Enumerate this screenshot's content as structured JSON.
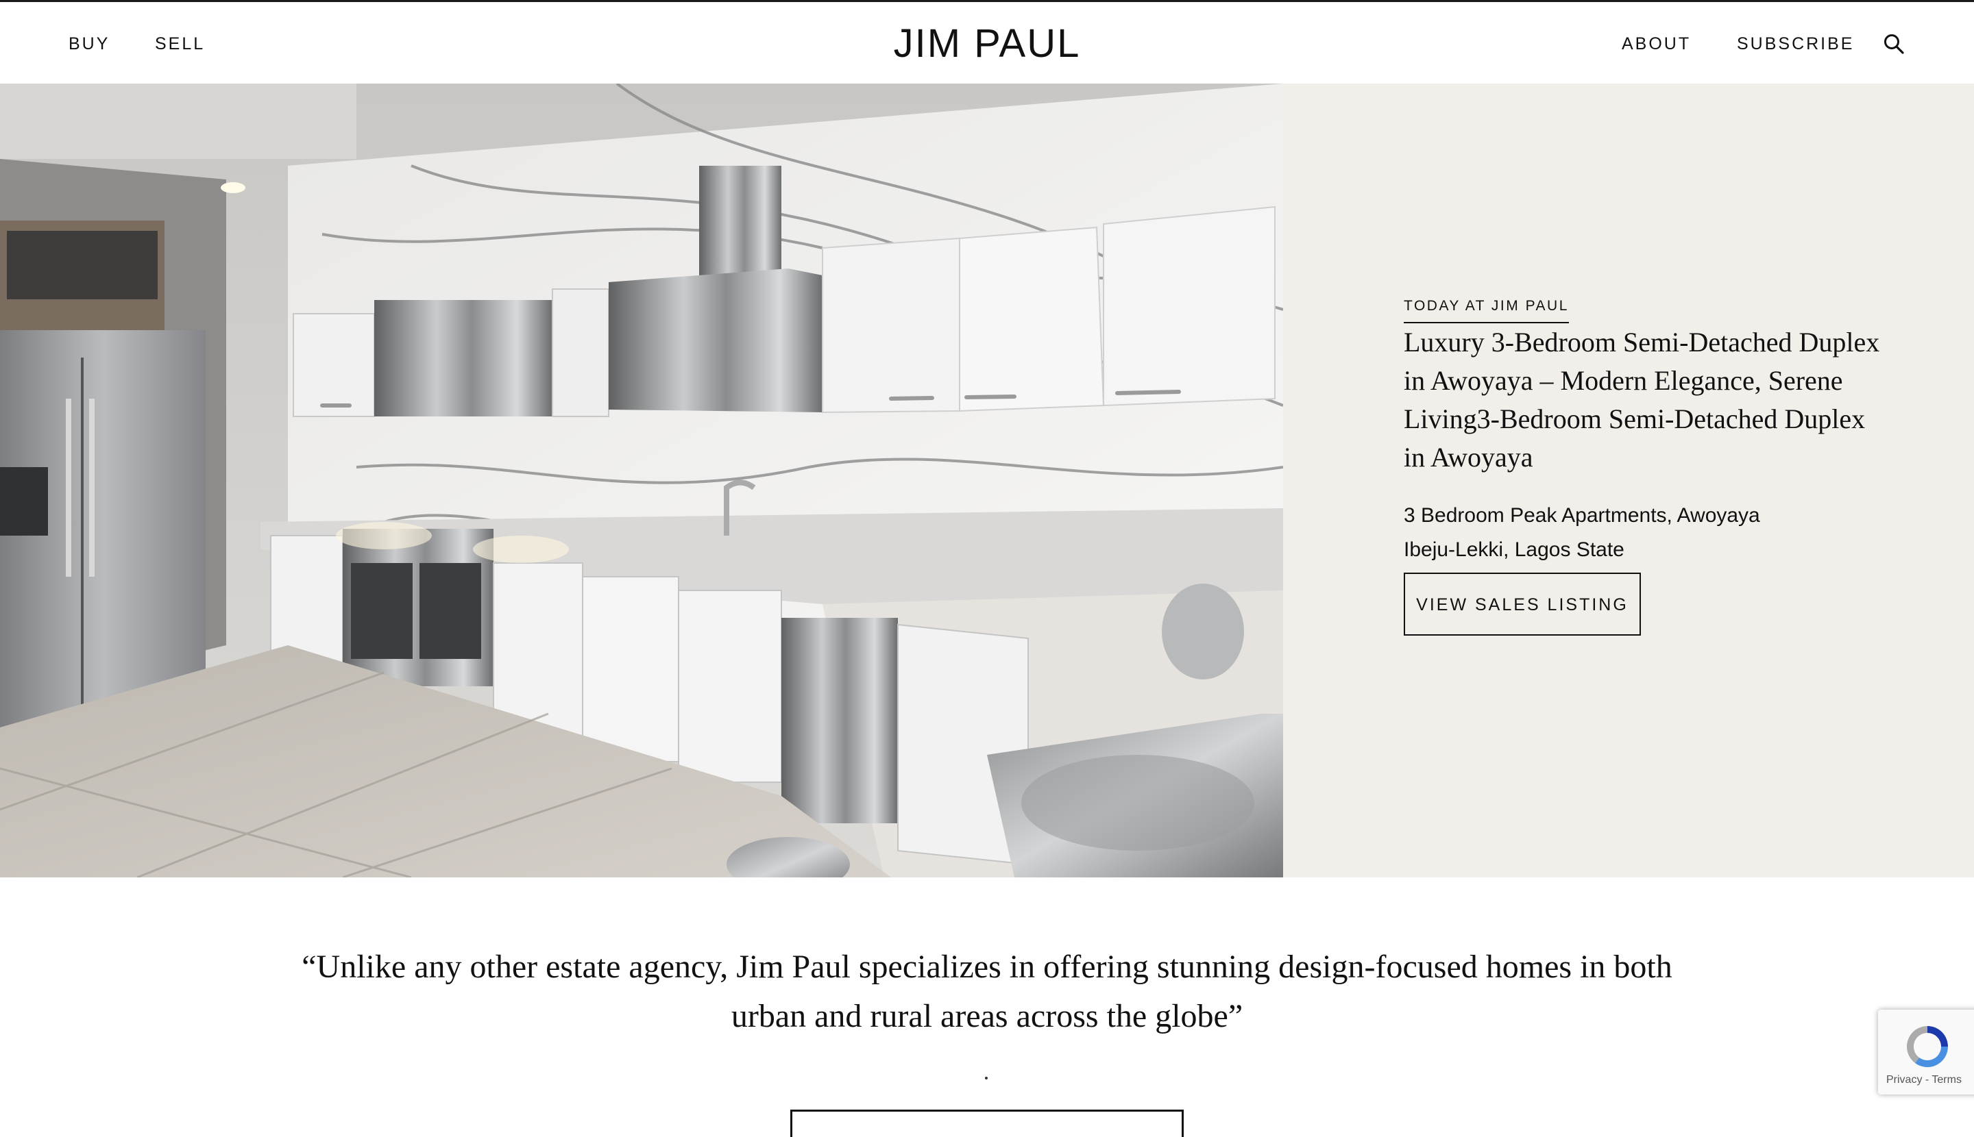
{
  "nav": {
    "buy": "BUY",
    "sell": "SELL",
    "logo": "JIM PAUL",
    "about": "ABOUT",
    "subscribe": "SUBSCRIBE"
  },
  "hero": {
    "eyebrow": "TODAY AT JIM PAUL",
    "headline": "Luxury 3-Bedroom Semi-Detached Duplex in Awoyaya – Modern Elegance, Serene Living3-Bedroom Semi-Detached Duplex in Awoyaya",
    "address_line1": "3 Bedroom Peak Apartments, Awoyaya",
    "address_line2": "Ibeju-Lekki, Lagos State",
    "cta": "VIEW SALES LISTING"
  },
  "quote": {
    "text": "“Unlike any other estate agency, Jim Paul specializes in offering stunning design-focused homes in both urban and rural areas across the globe”"
  },
  "recaptcha": {
    "links": "Privacy - Terms"
  },
  "colors": {
    "panel_bg": "#f2efea",
    "text": "#111111"
  }
}
